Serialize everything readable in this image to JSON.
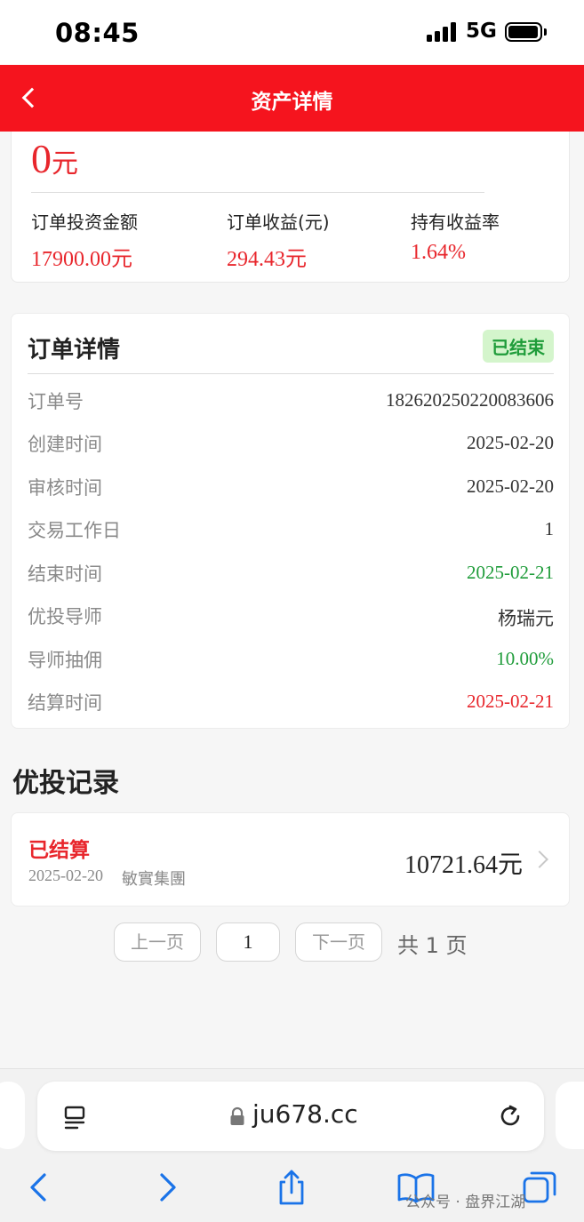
{
  "status_bar": {
    "time": "08:45",
    "network": "5G"
  },
  "header": {
    "title": "资产详情"
  },
  "assets": {
    "total_value": "0",
    "total_unit": "元",
    "stats": [
      {
        "label": "订单投资金额",
        "value": "17900.00元"
      },
      {
        "label": "订单收益(元)",
        "value": "294.43元"
      },
      {
        "label": "持有收益率",
        "value": "1.64%"
      }
    ]
  },
  "order": {
    "title": "订单详情",
    "status_badge": "已结束",
    "rows": [
      {
        "label": "订单号",
        "value": "182620250220083606"
      },
      {
        "label": "创建时间",
        "value": "2025-02-20"
      },
      {
        "label": "审核时间",
        "value": "2025-02-20"
      },
      {
        "label": "交易工作日",
        "value": "1"
      },
      {
        "label": "结束时间",
        "value": "2025-02-21"
      },
      {
        "label": "优投导师",
        "value": "杨瑞元"
      },
      {
        "label": "导师抽佣",
        "value": "10.00%"
      },
      {
        "label": "结算时间",
        "value": "2025-02-21"
      }
    ]
  },
  "records": {
    "title": "优投记录",
    "items": [
      {
        "status": "已结算",
        "date": "2025-02-20",
        "company": "敏實集團",
        "amount": "10721.64元"
      }
    ]
  },
  "pagination": {
    "prev": "上一页",
    "current": "1",
    "next": "下一页",
    "total": "共 1 页"
  },
  "browser": {
    "url": "ju678.cc"
  },
  "watermark": "公众号 · 盘界江湖",
  "colors": {
    "header_red": "#f5141e",
    "value_red": "#e8262c",
    "green": "#1f9c3a",
    "badge_bg": "#d4f5cc"
  },
  "icons": [
    "back-chevron-icon",
    "signal-icon",
    "battery-icon",
    "chevron-right-icon",
    "reader-menu-icon",
    "lock-icon",
    "reload-icon",
    "back-arrow-icon",
    "forward-arrow-icon",
    "share-icon",
    "bookmarks-icon",
    "tabs-icon"
  ]
}
